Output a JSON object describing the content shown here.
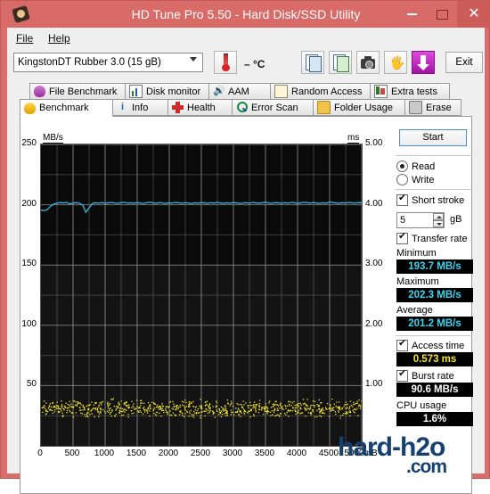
{
  "window": {
    "title": "HD Tune Pro 5.50 - Hard Disk/SSD Utility",
    "icon": "app-icon",
    "minimize": "minimize-icon",
    "maximize": "maximize-icon",
    "close": "close-icon",
    "titlebar_color": "#d86a67"
  },
  "menu": {
    "file": "File",
    "help": "Help"
  },
  "toolbar": {
    "device": "KingstonDT Rubber 3.0 (15 gB)",
    "temperature": "– °C",
    "exit_label": "Exit",
    "buttons": [
      "copy-icon",
      "copy-graph-icon",
      "camera-icon",
      "hand-icon",
      "download-icon"
    ]
  },
  "tabs_row1": [
    {
      "label": "File Benchmark",
      "icon": "bulb-purple-icon",
      "selected": false
    },
    {
      "label": "Disk monitor",
      "icon": "bar-chart-icon",
      "selected": false
    },
    {
      "label": "AAM",
      "icon": "speaker-icon",
      "selected": false
    },
    {
      "label": "Random Access",
      "icon": "scatter-icon",
      "selected": false
    },
    {
      "label": "Extra tests",
      "icon": "extra-icon",
      "selected": false
    }
  ],
  "tabs_row2": [
    {
      "label": "Benchmark",
      "icon": "bulb-yellow-icon",
      "selected": true
    },
    {
      "label": "Info",
      "icon": "info-icon",
      "selected": false
    },
    {
      "label": "Health",
      "icon": "cross-icon",
      "selected": false
    },
    {
      "label": "Error Scan",
      "icon": "magnifier-icon",
      "selected": false
    },
    {
      "label": "Folder Usage",
      "icon": "folder-icon",
      "selected": false
    },
    {
      "label": "Erase",
      "icon": "trash-icon",
      "selected": false
    }
  ],
  "panel": {
    "start_label": "Start",
    "read_label": "Read",
    "write_label": "Write",
    "read_selected": true,
    "short_stroke_label": "Short stroke",
    "short_stroke_checked": true,
    "short_stroke_value": "5",
    "short_stroke_unit": "gB",
    "transfer_rate_label": "Transfer rate",
    "transfer_rate_checked": true,
    "minimum_label": "Minimum",
    "minimum_value": "193.7 MB/s",
    "maximum_label": "Maximum",
    "maximum_value": "202.3 MB/s",
    "average_label": "Average",
    "average_value": "201.2 MB/s",
    "access_time_label": "Access time",
    "access_time_checked": true,
    "access_time_value": "0.573 ms",
    "burst_rate_label": "Burst rate",
    "burst_rate_checked": true,
    "burst_rate_value": "90.6 MB/s",
    "cpu_usage_label": "CPU usage",
    "cpu_usage_value": "1.6%"
  },
  "watermark": {
    "line1": "hard-h2o",
    "line2": ".com"
  },
  "chart_data": {
    "type": "line",
    "title": "",
    "xlabel": "",
    "ylabel": "MB/s",
    "y2label": "ms",
    "xlim": [
      0,
      5000
    ],
    "ylim": [
      0,
      250
    ],
    "y2lim": [
      0,
      5.0
    ],
    "x_unit": "mB",
    "xticks": [
      0,
      500,
      1000,
      1500,
      2000,
      2500,
      3000,
      3500,
      4000,
      4500,
      5000
    ],
    "xticklabels": [
      "0",
      "500",
      "1000",
      "1500",
      "2000",
      "2500",
      "3000",
      "3500",
      "4000",
      "4500",
      "5000mB"
    ],
    "yticks": [
      50,
      100,
      150,
      200,
      250
    ],
    "yticklabels": [
      "50",
      "100",
      "150",
      "200",
      "250"
    ],
    "y2ticks": [
      1.0,
      2.0,
      3.0,
      4.0,
      5.0
    ],
    "y2ticklabels": [
      "1.00",
      "2.00",
      "3.00",
      "4.00",
      "5.00"
    ],
    "grid": true,
    "background": "#0a0a0a",
    "series": [
      {
        "name": "Transfer rate",
        "type": "line",
        "color": "#3ab6e0",
        "axis": "left",
        "x": [
          0,
          50,
          100,
          150,
          200,
          250,
          300,
          350,
          400,
          450,
          500,
          550,
          600,
          650,
          700,
          750,
          800,
          850,
          900,
          950,
          1000,
          1050,
          1100,
          1150,
          1200,
          1250,
          1300,
          1350,
          1400,
          1450,
          1500,
          1550,
          1600,
          1650,
          1700,
          1750,
          1800,
          1850,
          1900,
          1950,
          2000,
          2050,
          2100,
          2150,
          2200,
          2250,
          2300,
          2350,
          2400,
          2450,
          2500,
          2550,
          2600,
          2650,
          2700,
          2750,
          2800,
          2850,
          2900,
          2950,
          3000,
          3050,
          3100,
          3150,
          3200,
          3250,
          3300,
          3350,
          3400,
          3450,
          3500,
          3550,
          3600,
          3650,
          3700,
          3750,
          3800,
          3850,
          3900,
          3950,
          4000,
          4050,
          4100,
          4150,
          4200,
          4250,
          4300,
          4350,
          4400,
          4450,
          4500,
          4550,
          4600,
          4650,
          4700,
          4750,
          4800,
          4850,
          4900,
          4950,
          5000
        ],
        "y": [
          195.5,
          195.2,
          196.0,
          198.8,
          200.6,
          201.3,
          201.8,
          201.5,
          201.9,
          200.7,
          201.4,
          201.8,
          201.2,
          199.8,
          193.7,
          197.5,
          201.0,
          201.6,
          201.3,
          201.8,
          201.2,
          201.5,
          201.9,
          201.4,
          201.1,
          201.7,
          202.0,
          201.3,
          201.6,
          201.2,
          201.8,
          201.4,
          201.0,
          201.7,
          202.1,
          201.5,
          201.2,
          201.8,
          201.4,
          201.1,
          201.6,
          201.3,
          201.9,
          201.5,
          201.2,
          201.7,
          201.4,
          201.0,
          201.6,
          201.3,
          201.8,
          201.5,
          201.1,
          201.7,
          201.3,
          201.9,
          201.4,
          201.2,
          201.6,
          201.3,
          201.8,
          201.5,
          201.1,
          201.4,
          201.7,
          201.2,
          201.9,
          201.5,
          201.3,
          201.6,
          202.2,
          201.4,
          201.1,
          201.8,
          201.5,
          201.2,
          201.7,
          201.3,
          201.9,
          201.6,
          201.2,
          201.5,
          202.0,
          201.7,
          201.3,
          201.8,
          201.4,
          201.1,
          201.6,
          201.3,
          202.3,
          201.8,
          201.5,
          201.2,
          201.7,
          201.4,
          201.9,
          201.6,
          201.3,
          201.8,
          201.5
        ]
      },
      {
        "name": "Access time",
        "type": "scatter",
        "color": "#f2e52a",
        "axis": "right",
        "mean": 0.573,
        "x": [
          20,
          60,
          90,
          140,
          180,
          210,
          250,
          300,
          340,
          380,
          420,
          460,
          500,
          540,
          580,
          620,
          660,
          700,
          740,
          780,
          820,
          860,
          900,
          940,
          980,
          1020,
          1060,
          1100,
          1140,
          1180,
          1220,
          1260,
          1300,
          1340,
          1380,
          1420,
          1460,
          1500,
          1540,
          1580,
          1620,
          1660,
          1700,
          1740,
          1780,
          1820,
          1860,
          1900,
          1940,
          1980,
          2020,
          2060,
          2100,
          2140,
          2180,
          2220,
          2260,
          2300,
          2340,
          2380,
          2420,
          2460,
          2500,
          2540,
          2580,
          2620,
          2660,
          2700,
          2740,
          2780,
          2820,
          2860,
          2900,
          2940,
          2980,
          3020,
          3060,
          3100,
          3140,
          3180,
          3220,
          3260,
          3300,
          3340,
          3380,
          3420,
          3460,
          3500,
          3540,
          3580,
          3620,
          3660,
          3700,
          3740,
          3780,
          3820,
          3860,
          3900,
          3940,
          3980,
          4020,
          4060,
          4100,
          4140,
          4180,
          4220,
          4260,
          4300,
          4340,
          4380,
          4420,
          4460,
          4500,
          4540,
          4580,
          4620,
          4660,
          4700,
          4740,
          4780,
          4820,
          4860,
          4900,
          4940,
          4980
        ],
        "y": [
          0.52,
          0.61,
          0.55,
          0.58,
          0.62,
          0.54,
          0.59,
          0.63,
          0.56,
          0.6,
          0.57,
          0.64,
          0.53,
          0.61,
          0.58,
          0.62,
          0.55,
          0.59,
          0.63,
          0.57,
          0.6,
          0.54,
          0.62,
          0.58,
          0.61,
          0.56,
          0.59,
          0.64,
          0.53,
          0.6,
          0.57,
          0.62,
          0.55,
          0.58,
          0.63,
          0.59,
          0.56,
          0.61,
          0.54,
          0.6,
          0.57,
          0.63,
          0.58,
          0.55,
          0.62,
          0.59,
          0.53,
          0.61,
          0.57,
          0.6,
          0.56,
          0.63,
          0.58,
          0.54,
          0.61,
          0.59,
          0.55,
          0.62,
          0.57,
          0.6,
          0.53,
          0.58,
          0.64,
          0.56,
          0.61,
          0.59,
          0.54,
          0.62,
          0.57,
          0.6,
          0.55,
          0.63,
          0.58,
          0.56,
          0.61,
          0.59,
          0.53,
          0.6,
          0.57,
          0.62,
          0.55,
          0.58,
          0.64,
          0.56,
          0.61,
          0.59,
          0.54,
          0.62,
          0.57,
          0.6,
          0.55,
          0.58,
          0.63,
          0.56,
          0.61,
          0.59,
          0.53,
          0.6,
          0.57,
          0.62,
          0.55,
          0.58,
          0.64,
          0.56,
          0.61,
          0.59,
          0.54,
          0.62,
          0.57,
          0.6,
          0.55,
          0.58,
          0.63,
          0.56,
          0.61,
          0.59,
          0.53,
          0.6,
          0.57,
          0.62,
          0.55,
          0.58,
          0.64,
          0.56,
          0.61
        ]
      }
    ]
  }
}
